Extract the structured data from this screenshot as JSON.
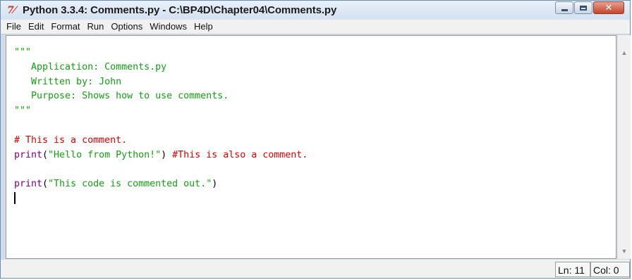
{
  "window": {
    "title": "Python 3.3.4: Comments.py - C:\\BP4D\\Chapter04\\Comments.py",
    "icon": "tk-icon",
    "icon_glyph": "7⁄",
    "buttons": {
      "minimize": "minimize-icon",
      "maximize": "maximize-icon",
      "close": "close-icon",
      "close_glyph": "✕"
    }
  },
  "menu": {
    "items": [
      "File",
      "Edit",
      "Format",
      "Run",
      "Options",
      "Windows",
      "Help"
    ]
  },
  "editor": {
    "lines": [
      [
        {
          "t": "\"\"\"",
          "c": "str"
        }
      ],
      [
        {
          "t": "   Application: Comments.py",
          "c": "str"
        }
      ],
      [
        {
          "t": "   Written by: John",
          "c": "str"
        }
      ],
      [
        {
          "t": "   Purpose: Shows how to use comments.",
          "c": "str"
        }
      ],
      [
        {
          "t": "\"\"\"",
          "c": "str"
        }
      ],
      [
        {
          "t": "",
          "c": "plain"
        }
      ],
      [
        {
          "t": "# This is a comment.",
          "c": "cmt"
        }
      ],
      [
        {
          "t": "print",
          "c": "kw"
        },
        {
          "t": "(",
          "c": "plain"
        },
        {
          "t": "\"Hello from Python!\"",
          "c": "str"
        },
        {
          "t": ") ",
          "c": "plain"
        },
        {
          "t": "#This is also a comment.",
          "c": "cmt"
        }
      ],
      [
        {
          "t": "",
          "c": "plain"
        }
      ],
      [
        {
          "t": "print",
          "c": "kw"
        },
        {
          "t": "(",
          "c": "plain"
        },
        {
          "t": "\"This code is commented out.\"",
          "c": "str"
        },
        {
          "t": ")",
          "c": "plain"
        }
      ],
      [
        {
          "t": "",
          "c": "cursor"
        }
      ]
    ],
    "colors": {
      "string": "#12a012",
      "comment": "#dd0000",
      "builtin": "#800080"
    }
  },
  "scrollbar": {
    "up_icon": "scroll-up-arrow-icon",
    "down_icon": "scroll-down-arrow-icon",
    "up_glyph": "▲",
    "down_glyph": "▼"
  },
  "status": {
    "line": "Ln: 11",
    "column": "Col: 0"
  }
}
